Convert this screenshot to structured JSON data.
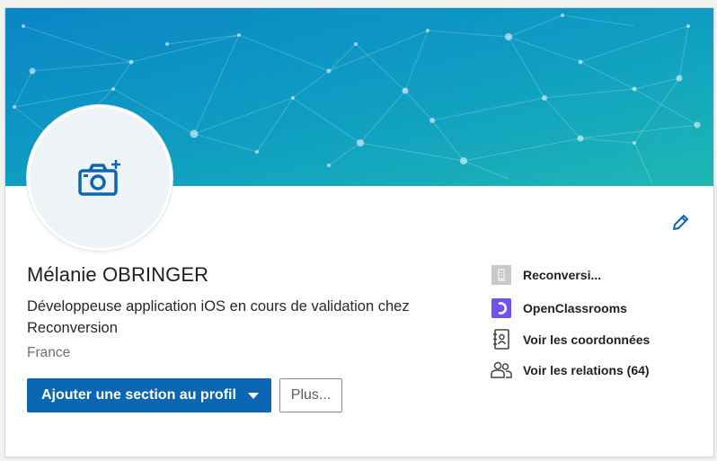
{
  "profile": {
    "name": "Mélanie OBRINGER",
    "headline": "Développeuse application iOS en cours de validation chez Reconversion",
    "location": "France"
  },
  "actions": {
    "add_section_label": "Ajouter une section au profil",
    "more_label": "Plus..."
  },
  "sidebar": {
    "company": {
      "label": "Reconversi...",
      "icon": "building-icon"
    },
    "school": {
      "label": "OpenClassrooms",
      "icon": "openclassrooms-logo-icon"
    },
    "contact": {
      "label": "Voir les coordonnées",
      "icon": "address-book-icon"
    },
    "connections": {
      "label": "Voir les relations (64)",
      "icon": "people-icon"
    }
  },
  "colors": {
    "primary": "#0b66b3",
    "banner_start": "#0a8fc4",
    "banner_end": "#19b3b5",
    "openclassrooms": "#7451eb"
  }
}
